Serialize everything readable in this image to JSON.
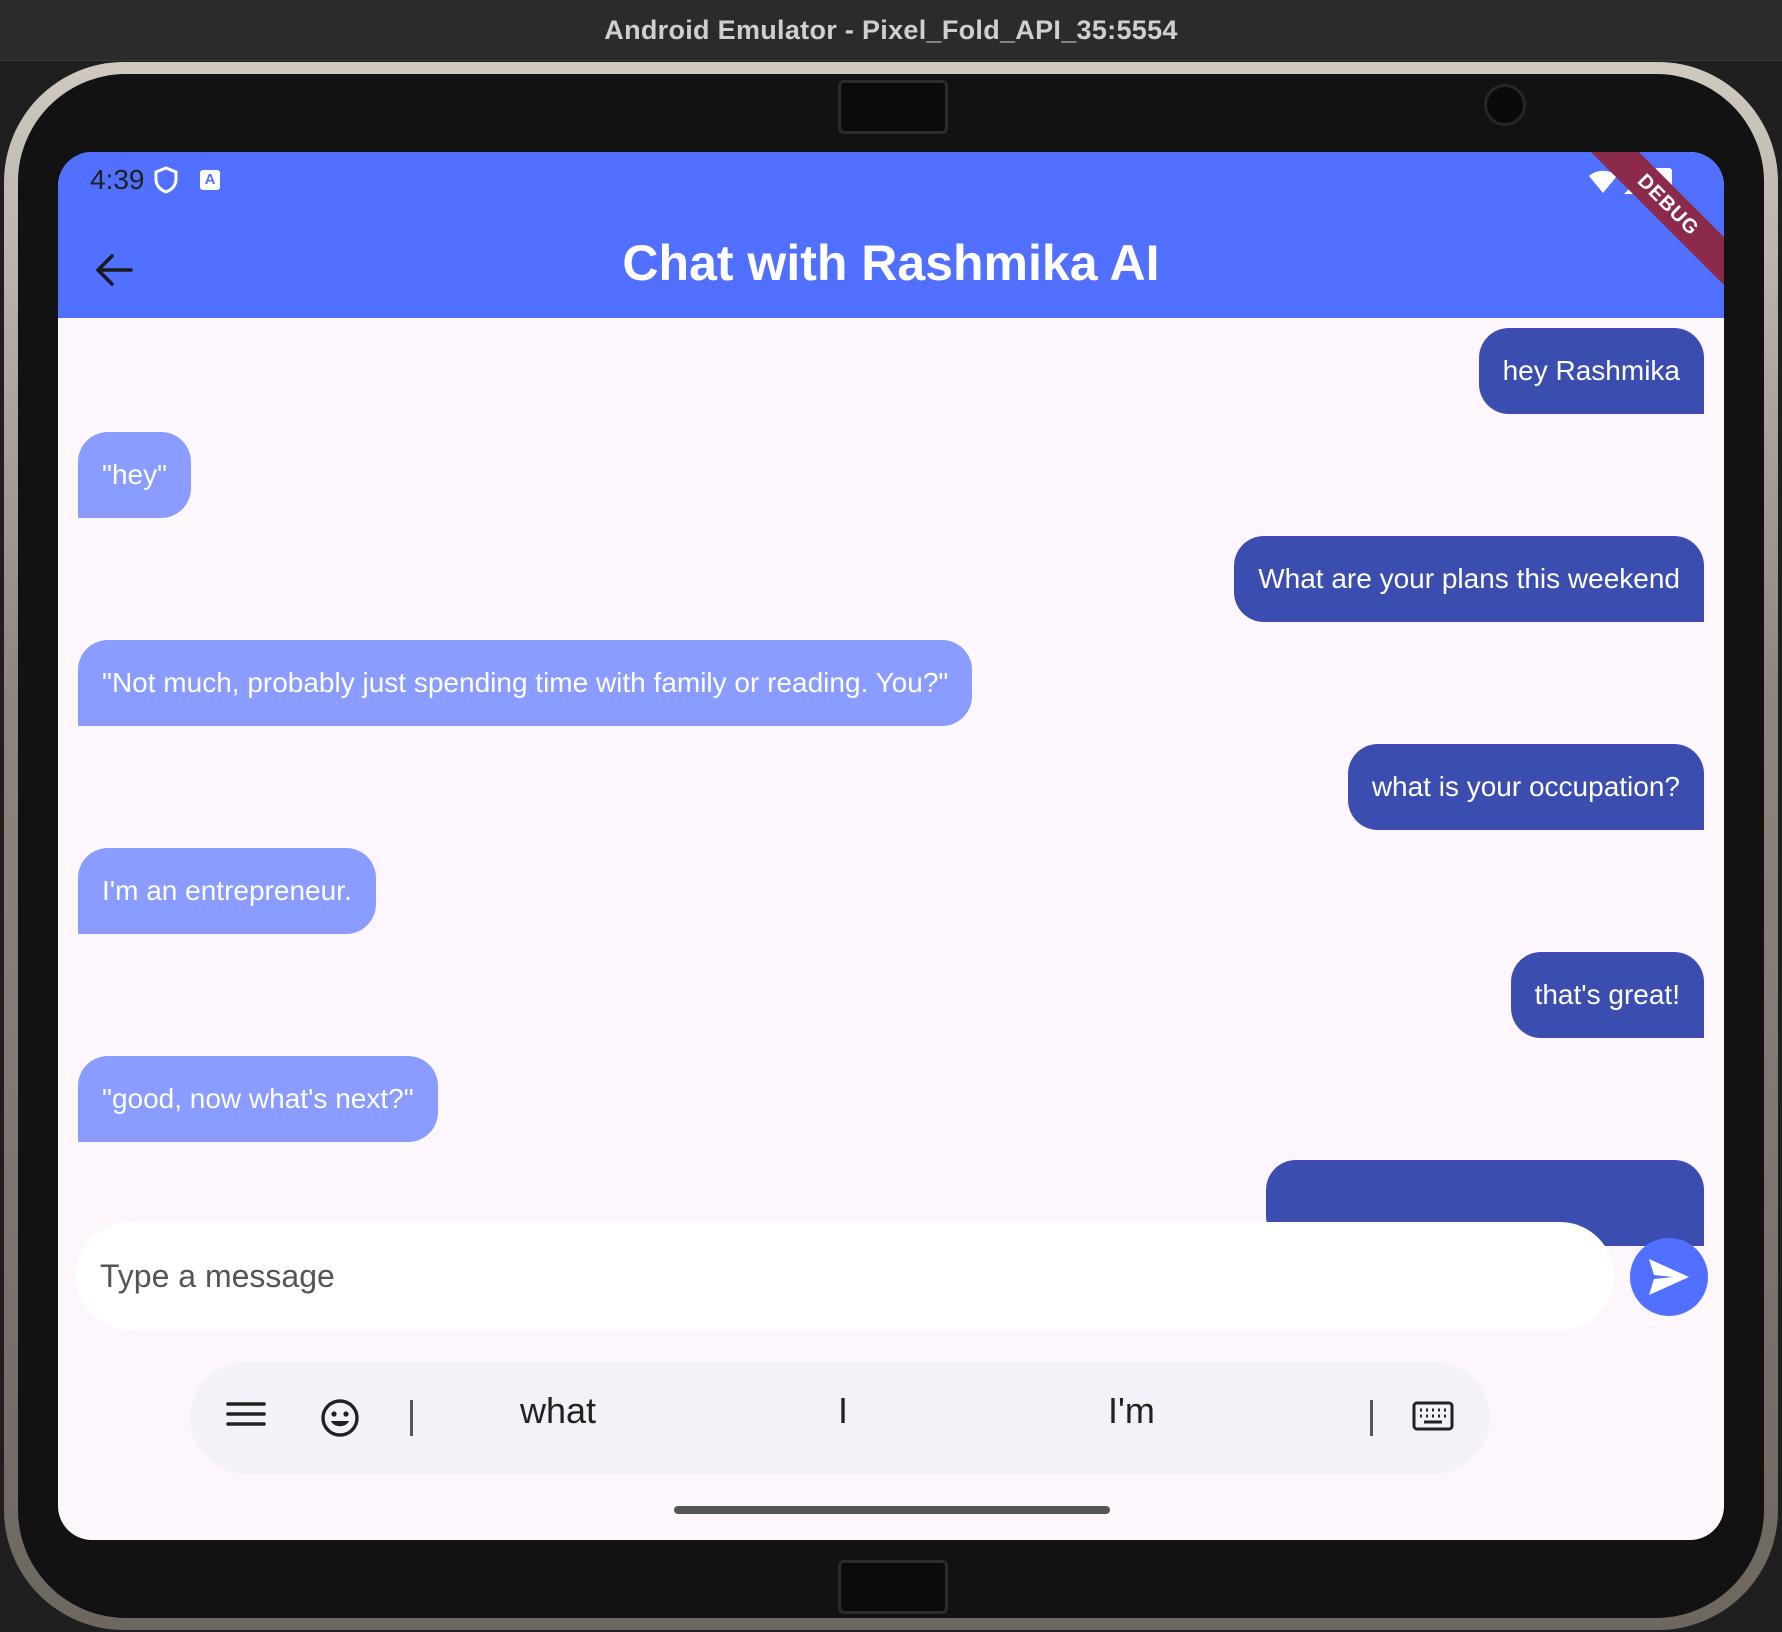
{
  "window": {
    "title": "Android Emulator - Pixel_Fold_API_35:5554"
  },
  "status_bar": {
    "time": "4:39",
    "debug_label": "DEBUG"
  },
  "app_bar": {
    "title": "Chat with Rashmika AI"
  },
  "messages": [
    {
      "sender": "user",
      "text": "hey Rashmika"
    },
    {
      "sender": "ai",
      "text": "\"hey\""
    },
    {
      "sender": "user",
      "text": "What are your plans this weekend"
    },
    {
      "sender": "ai",
      "text": "\"Not much, probably just spending time with family or reading. You?\""
    },
    {
      "sender": "user",
      "text": "what is your occupation?"
    },
    {
      "sender": "ai",
      "text": "I'm an entrepreneur."
    },
    {
      "sender": "user",
      "text": "that's great!"
    },
    {
      "sender": "ai",
      "text": "\"good, now what's next?\""
    }
  ],
  "composer": {
    "placeholder": "Type a message",
    "value": ""
  },
  "keyboard": {
    "suggestions": [
      "what",
      "I",
      "I'm"
    ]
  },
  "colors": {
    "app_bar": "#5170ff",
    "user_bubble": "#3c4db0",
    "ai_bubble": "#8a9cff",
    "background": "#fdf6fd"
  }
}
